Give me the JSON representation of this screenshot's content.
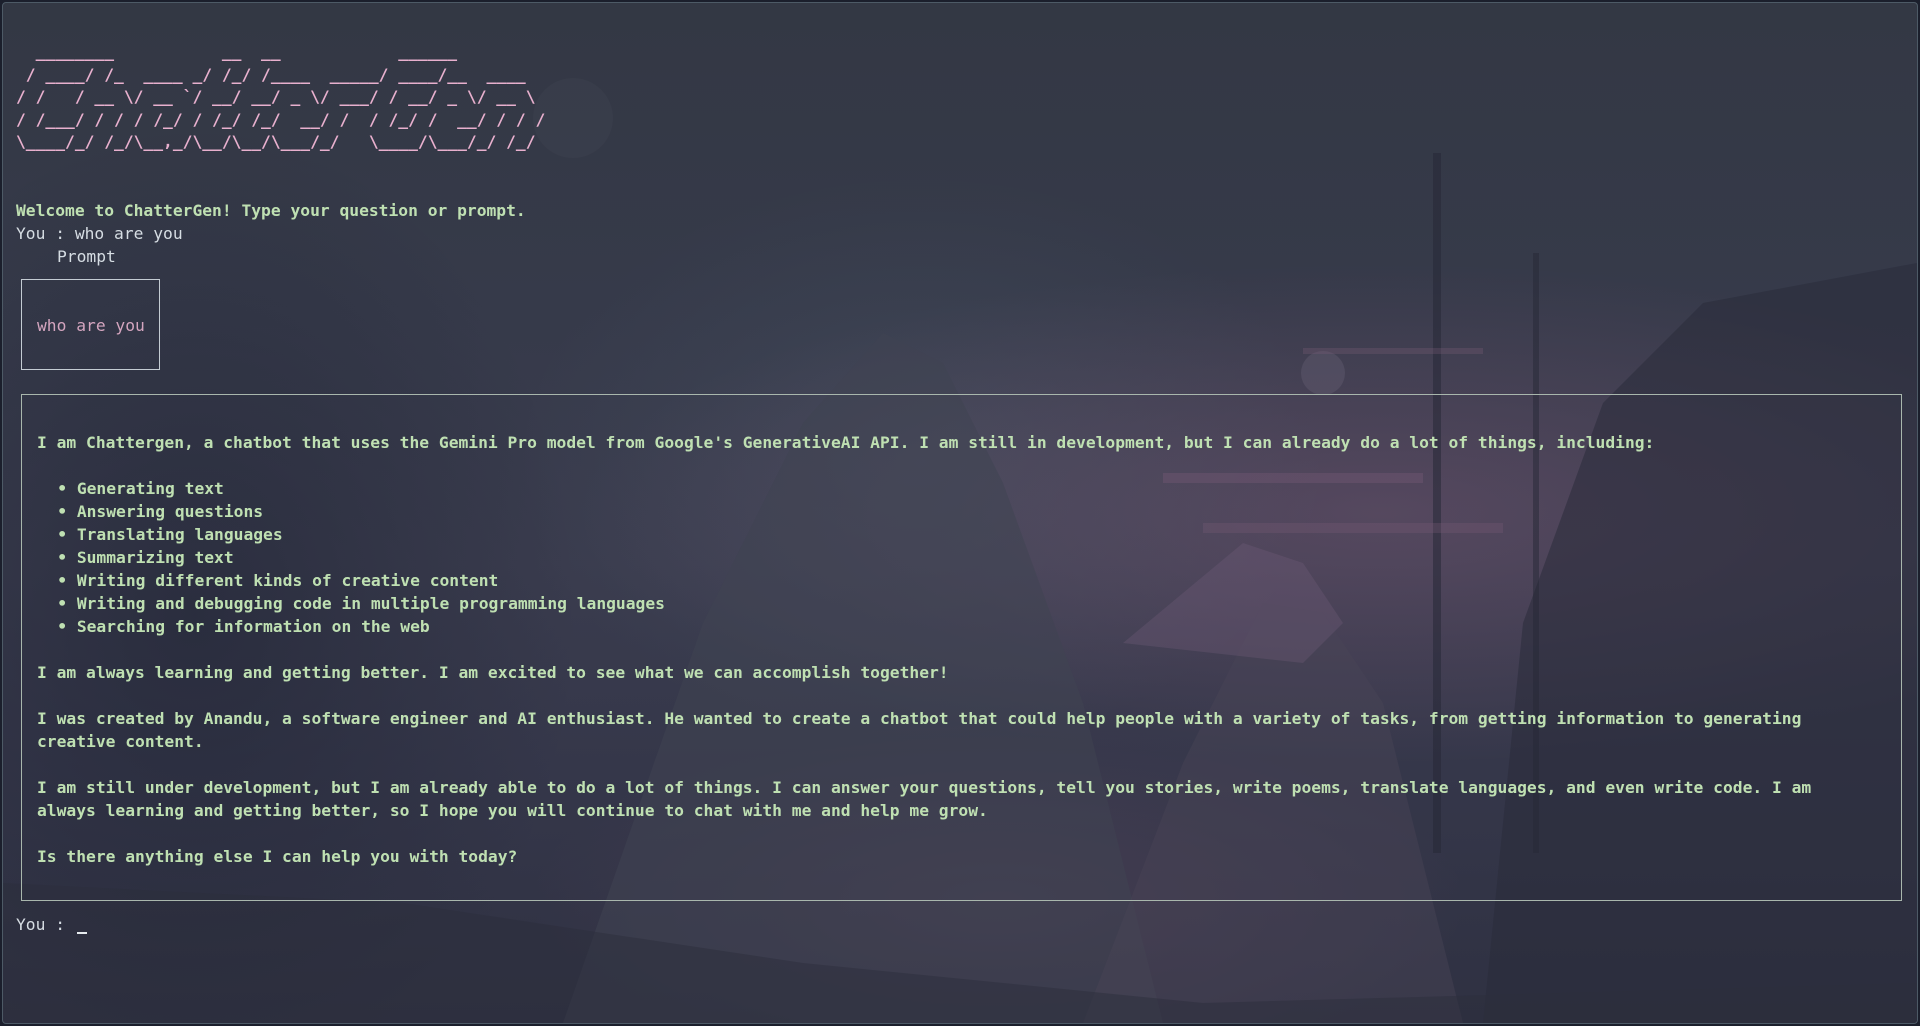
{
  "theme": {
    "banner_color": "#e8b0ce",
    "text_color": "#d6dde3",
    "response_color": "#bfe0b2",
    "prompt_text_color": "#d4a5bf",
    "border_color": "#c4ccd3"
  },
  "banner": {
    "ascii_art": "  ________           __  __            ______\n / ____/ /_  ____ _/ /_/ /____  _____/ ____/__  ____\n/ /   / __ \\/ __ `/ __/ __/ _ \\/ ___/ / __/ _ \\/ __ \\\n/ /___/ / / / /_/ / /_/ /_/  __/ /  / /_/ /  __/ / / /\n\\____/_/ /_/\\__,_/\\__/\\__/\\___/_/   \\____/\\___/_/ /_/"
  },
  "welcome_text": "Welcome to ChatterGen! Type your question or prompt.",
  "history": {
    "you_label": "You : ",
    "user_message": "who are you",
    "prompt_title": "Prompt",
    "prompt_text": "who are you"
  },
  "response": {
    "intro": "I am Chattergen, a chatbot that uses the Gemini Pro model from Google's GenerativeAI API. I am still in development, but I can already do a lot of things, including:",
    "bullet_char": "•",
    "capabilities": [
      "Generating text",
      "Answering questions",
      "Translating languages",
      "Summarizing text",
      "Writing different kinds of creative content",
      "Writing and debugging code in multiple programming languages",
      "Searching for information on the web"
    ],
    "paragraph_learning": "I am always learning and getting better. I am excited to see what we can accomplish together!",
    "paragraph_creator": "I was created by Anandu, a software engineer and AI enthusiast. He wanted to create a chatbot that could help people with a variety of tasks, from getting information to generating\ncreative content.",
    "paragraph_abilities": "I am still under development, but I am already able to do a lot of things. I can answer your questions, tell you stories, write poems, translate languages, and even write code. I am\nalways learning and getting better, so I hope you will continue to chat with me and help me grow.",
    "closing": "Is there anything else I can help you with today?"
  },
  "input": {
    "label": "You : ",
    "value": ""
  }
}
